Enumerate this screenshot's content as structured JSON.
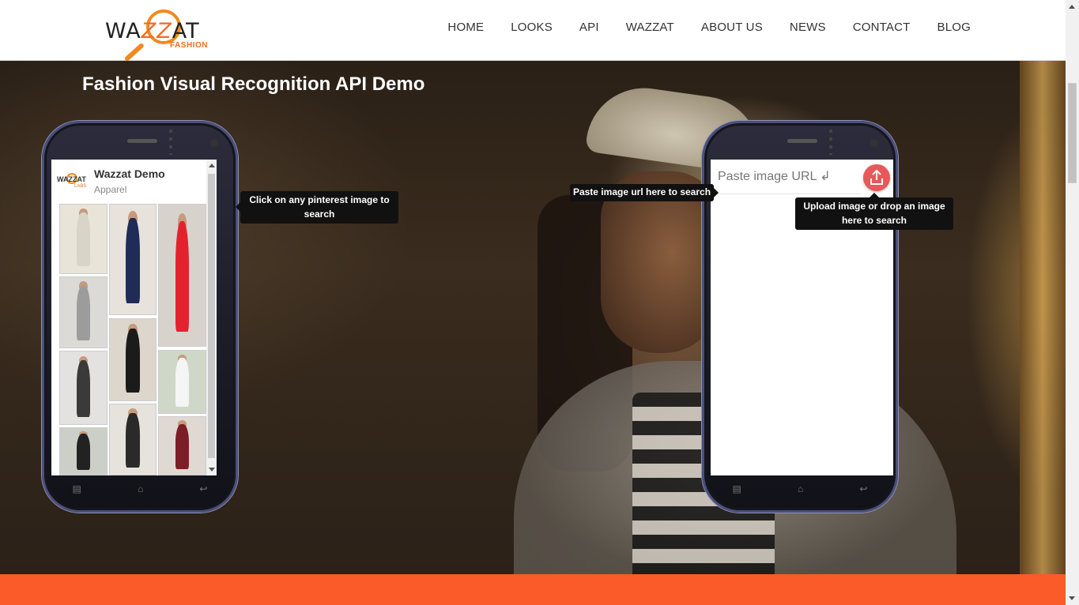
{
  "header": {
    "logo_word_pre": "WA",
    "logo_word_zz": "ZZ",
    "logo_word_post": "AT",
    "logo_sub": "FASHION",
    "nav": [
      "HOME",
      "LOOKS",
      "API",
      "WAZZAT",
      "ABOUT US",
      "NEWS",
      "CONTACT",
      "BLOG"
    ]
  },
  "hero": {
    "title": "Fashion Visual Recognition API Demo"
  },
  "left_phone": {
    "board_logo_text": "WAZZAT",
    "board_logo_sub": "LABS",
    "board_title": "Wazzat Demo",
    "board_subtitle": "Apparel",
    "softkeys": [
      "▤",
      "⌂",
      "↩"
    ],
    "thumbs": [
      {
        "color": "#e9e4d8",
        "outfit": "#d9d4c8"
      },
      {
        "color": "#e7e3dc",
        "outfit": "#1f2c58"
      },
      {
        "color": "#d8d2cc",
        "outfit": "#e3222f"
      },
      {
        "color": "#dcdad6",
        "outfit": "#9c9c9c"
      },
      {
        "color": "#ddd6cc",
        "outfit": "#1b1b1b"
      },
      {
        "color": "#cfd8c8",
        "outfit": "#f5f5f5"
      },
      {
        "color": "#e4e2e0",
        "outfit": "#3a3a3a"
      },
      {
        "color": "#e6e2dc",
        "outfit": "#2a2a2a"
      },
      {
        "color": "#e0d8d2",
        "outfit": "#7b1e27"
      },
      {
        "color": "#cbcfc8",
        "outfit": "#222222"
      }
    ]
  },
  "right_phone": {
    "url_placeholder": "Paste image URL ↲",
    "softkeys": [
      "▤",
      "⌂",
      "↩"
    ]
  },
  "tooltips": {
    "pinterest": "Click on any pinterest image to search",
    "paste_url": "Paste image url here to search",
    "upload": "Upload image or drop an image here to search"
  },
  "colors": {
    "brand_orange": "#fb5a29",
    "upload_button": "#e8585a"
  }
}
